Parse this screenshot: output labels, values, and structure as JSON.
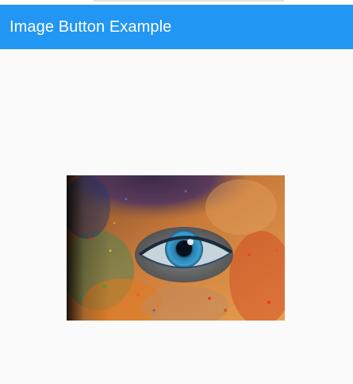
{
  "app_bar": {
    "title": "Image Button Example",
    "background": "#2196f3",
    "title_color": "#ffffff"
  },
  "content": {
    "background": "#fafafa",
    "image_button": {
      "description": "close-up of a blue eye surrounded by multicolored powder paint",
      "icon": "eye-photo-image"
    }
  }
}
